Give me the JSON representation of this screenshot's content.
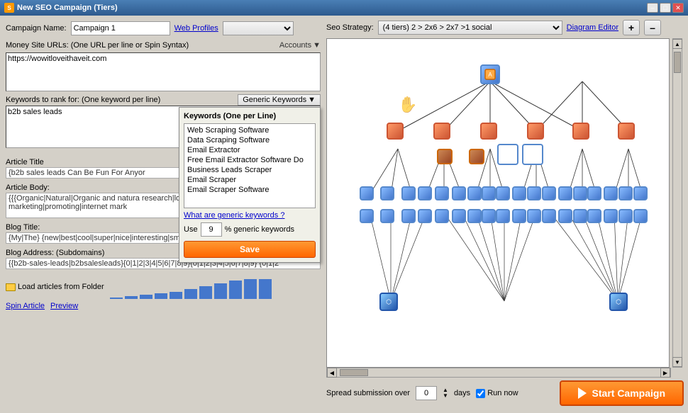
{
  "titleBar": {
    "title": "New SEO Campaign (Tiers)",
    "minimizeLabel": "–",
    "maximizeLabel": "□",
    "closeLabel": "✕"
  },
  "leftPanel": {
    "campaignNameLabel": "Campaign Name:",
    "campaignNameValue": "Campaign 1",
    "webProfilesLabel": "Web Profiles",
    "webProfilesOptions": [
      ""
    ],
    "moneySiteLabel": "Money Site URLs:  (One URL per line or Spin Syntax)",
    "accountsLabel": "Accounts",
    "moneySiteValue": "https://wowitloveithaveit.com",
    "keywordsLabel": "Keywords to rank for:  (One keyword per line)",
    "genericKwLabel": "Generic Keywords",
    "keywordsValue": "b2b sales leads",
    "genericKeywordsPopup": {
      "title": "Keywords (One per Line)",
      "items": [
        "Web Scraping Software",
        "Data Scraping Software",
        "Email Extractor",
        "Free Email Extractor Software Do",
        "Business Leads Scraper",
        "Email Scraper",
        "Email Scraper Software"
      ],
      "whatAreLink": "What are generic keywords ?",
      "useLabel": "Use",
      "useValue": "9",
      "percentLabel": "%  generic keywords",
      "saveLabel": "Save"
    },
    "articleTitleLabel": "Article Title",
    "articleTitleValue": "{b2b sales leads Can Be Fun For Anyor",
    "articleBodyLabel": "Article Body:",
    "articleBodyValue": "{{{Organic|Natural|Organic and natura research|look for} {marketing|advertisi and marketing|promoting|internet mark",
    "blogTitleLabel": "Blog Title:",
    "blogTitleValue": "{My|The} {new|best|cool|super|nice|interesting|smart|great|impressive|inspiring|sp",
    "blogAddressLabel": "Blog Address: (Subdomains)",
    "blogAddressValue": "{{b2b-sales-leads|b2bsalesleads}{0|1|2|3|4|5|6|7|8|9}{0|1|2|3|4|5|6|7|8|9} {0|1|2",
    "loadFolderLabel": "Load articles from Folder",
    "spinArticleLabel": "Spin Article",
    "previewLabel": "Preview"
  },
  "rightPanel": {
    "seoStrategyLabel": "Seo Strategy:",
    "seoStrategyValue": "(4 tiers)  2 > 2x6 > 2x7 >1 social",
    "diagramEditorLabel": "Diagram Editor",
    "zoomInLabel": "+",
    "zoomOutLabel": "–",
    "spreadLabel": "Spread submission over",
    "daysValue": "0",
    "daysLabel": "days",
    "runNowLabel": "Run now",
    "startCampaignLabel": "Start Campaign"
  },
  "chartBars": [
    2,
    4,
    6,
    8,
    10,
    14,
    18,
    22,
    26,
    28,
    28
  ]
}
